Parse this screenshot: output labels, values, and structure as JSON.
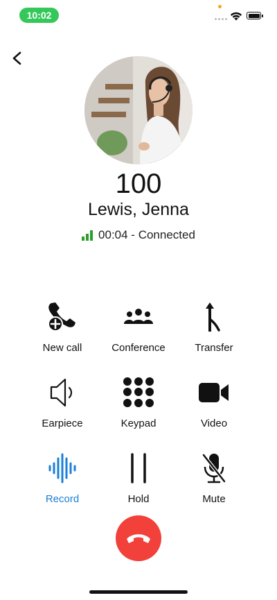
{
  "status_bar": {
    "time": "10:02"
  },
  "contact": {
    "number": "100",
    "name": "Lewis, Jenna",
    "call_status": "00:04 - Connected"
  },
  "actions": [
    {
      "label": "New call",
      "icon": "add-call-icon"
    },
    {
      "label": "Conference",
      "icon": "conference-icon"
    },
    {
      "label": "Transfer",
      "icon": "transfer-icon"
    },
    {
      "label": "Earpiece",
      "icon": "speaker-icon"
    },
    {
      "label": "Keypad",
      "icon": "keypad-icon"
    },
    {
      "label": "Video",
      "icon": "video-icon"
    },
    {
      "label": "Record",
      "icon": "record-icon",
      "active": true
    },
    {
      "label": "Hold",
      "icon": "hold-icon"
    },
    {
      "label": "Mute",
      "icon": "mute-icon"
    }
  ],
  "colors": {
    "time_pill": "#34c759",
    "signal": "#2a9d2a",
    "active_action": "#1a7fd6",
    "end_call": "#f2403a"
  }
}
